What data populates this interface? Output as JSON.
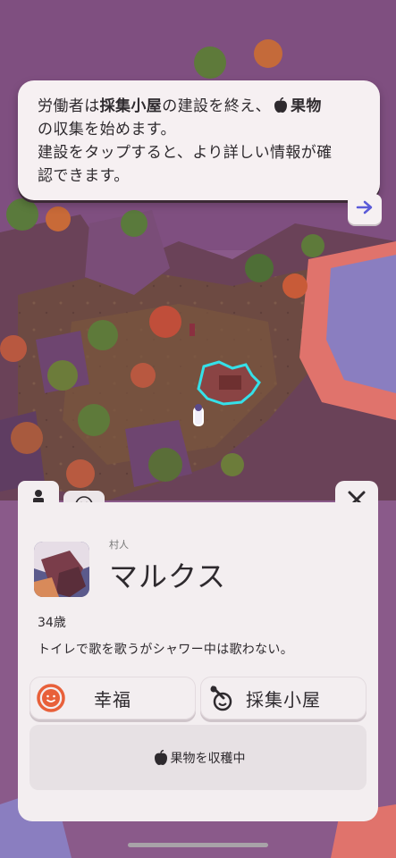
{
  "tooltip": {
    "line1_pre": "労働者は",
    "line1_building": "採集小屋",
    "line1_mid": "の建設を終え、",
    "line1_resource": "果物",
    "line2": "の収集を始めます。",
    "line3": "建設をタップすると、より詳しい情報が確",
    "line4": "認できます。",
    "next_icon": "arrow-right-icon"
  },
  "panel": {
    "tabs": [
      "person-icon",
      "smiley-icon"
    ],
    "close_icon": "close-icon",
    "role": "村人",
    "name": "マルクス",
    "age": "34歳",
    "description": "トイレで歌を歌うがシャワー中は歌わない。",
    "happiness_label": "幸福",
    "workplace_label": "採集小屋",
    "status": "果物を収穫中"
  },
  "colors": {
    "panel_bg": "#f3eef0",
    "accent_orange": "#e8603a",
    "arrow_blue": "#5a5ad8",
    "highlight_cyan": "#35e0e8"
  }
}
